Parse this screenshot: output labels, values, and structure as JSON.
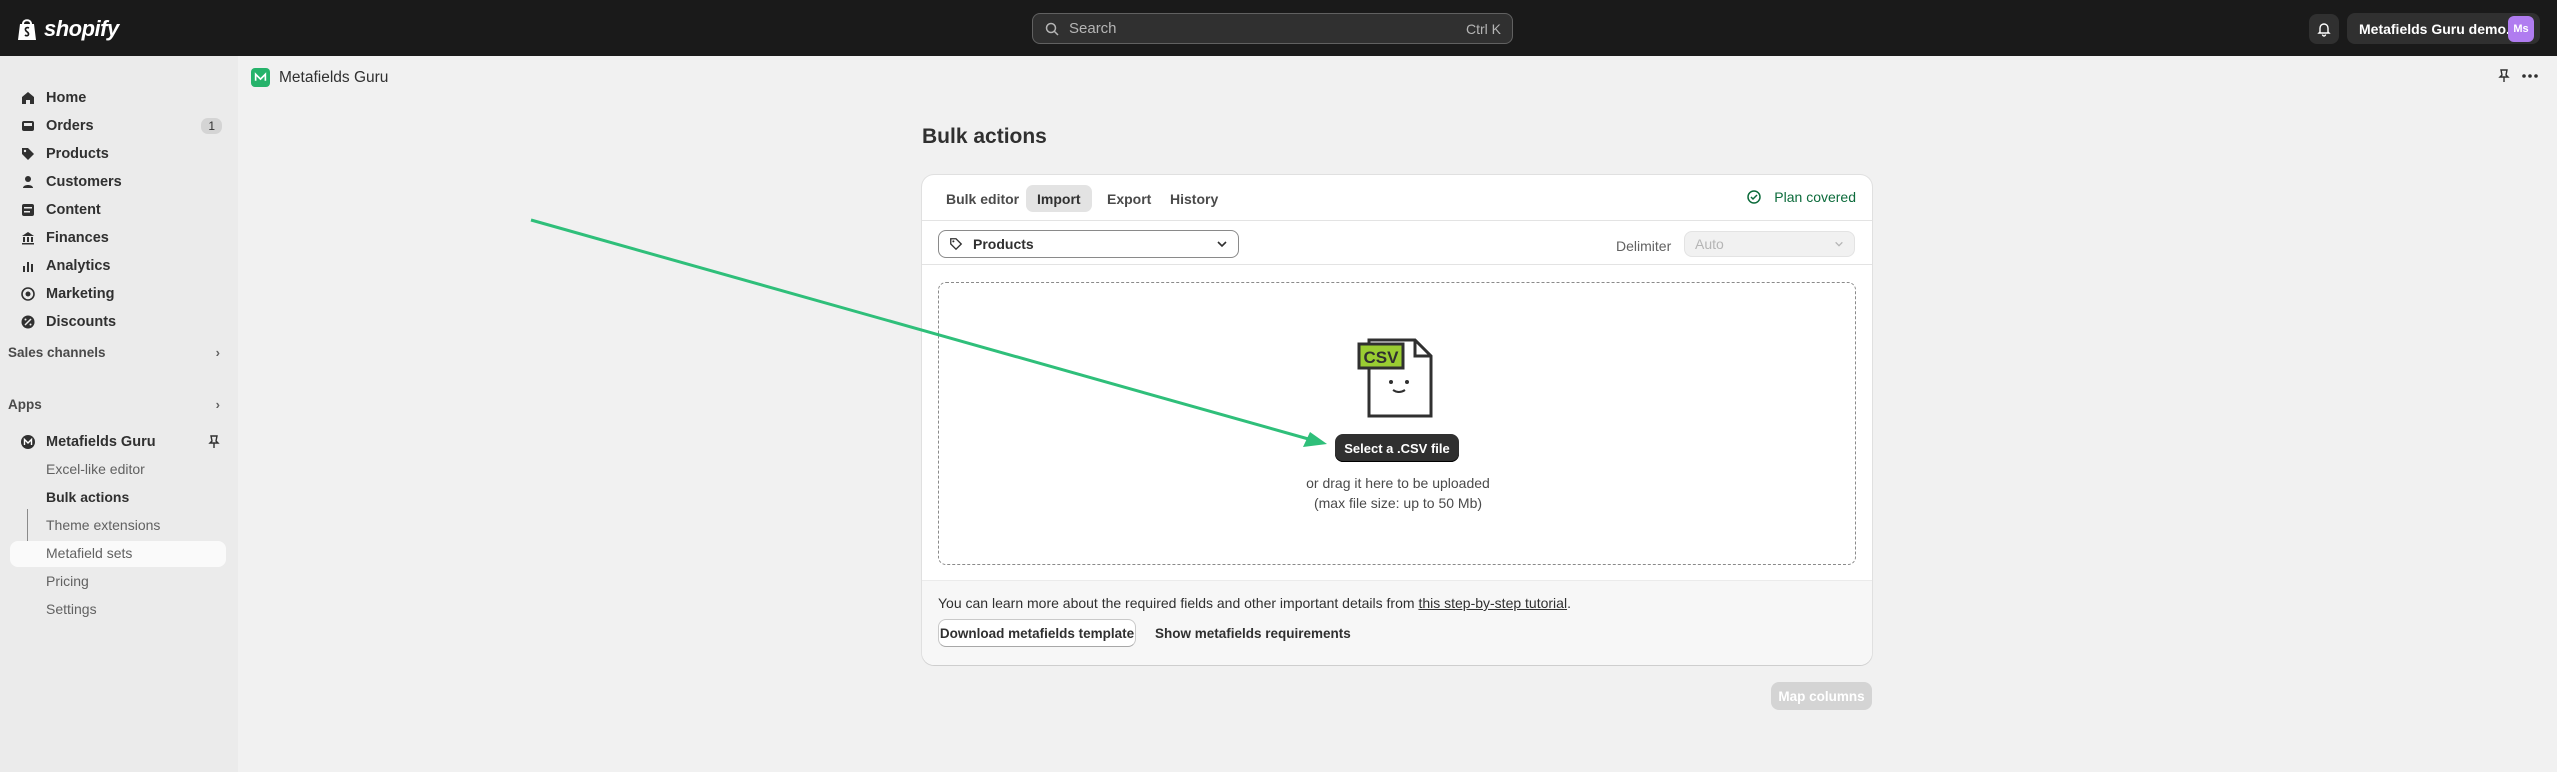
{
  "topbar": {
    "logo_text": "shopify",
    "search_placeholder": "Search",
    "search_shortcut": "Ctrl K",
    "store_name": "Metafields Guru demo...",
    "avatar_initials": "Ms"
  },
  "sidebar": {
    "items": [
      {
        "label": "Home",
        "icon": "home-icon"
      },
      {
        "label": "Orders",
        "icon": "orders-icon",
        "badge": "1"
      },
      {
        "label": "Products",
        "icon": "tag-icon"
      },
      {
        "label": "Customers",
        "icon": "person-icon"
      },
      {
        "label": "Content",
        "icon": "content-icon"
      },
      {
        "label": "Finances",
        "icon": "bank-icon"
      },
      {
        "label": "Analytics",
        "icon": "chart-icon"
      },
      {
        "label": "Marketing",
        "icon": "target-icon"
      },
      {
        "label": "Discounts",
        "icon": "discount-icon"
      }
    ],
    "sales_channels": "Sales channels",
    "apps": "Apps",
    "app_name": "Metafields Guru",
    "app_sub_items": [
      "Excel-like editor",
      "Bulk actions",
      "Theme extensions",
      "Metafield sets",
      "Pricing",
      "Settings"
    ]
  },
  "app_header": {
    "title": "Metafields Guru"
  },
  "page": {
    "title": "Bulk actions",
    "tabs": [
      "Bulk editor",
      "Import",
      "Export",
      "History"
    ],
    "active_tab": "Import",
    "plan_status": "Plan covered",
    "resource_select": "Products",
    "delimiter_label": "Delimiter",
    "delimiter_value": "Auto",
    "csv_icon_label": "CSV",
    "select_button": "Select a .CSV file",
    "drag_text": "or drag it here to be uploaded",
    "size_text": "(max file size: up to 50 Mb)",
    "learn_prefix": "You can learn more about the required fields and other important details from ",
    "learn_link": "this step-by-step tutorial",
    "learn_suffix": ".",
    "download_button": "Download metafields template",
    "requirements_button": "Show metafields requirements",
    "map_button": "Map columns"
  },
  "colors": {
    "accent_green": "#26b36b",
    "arrow": "#2fbf7a",
    "topbar": "#1a1a1a"
  }
}
